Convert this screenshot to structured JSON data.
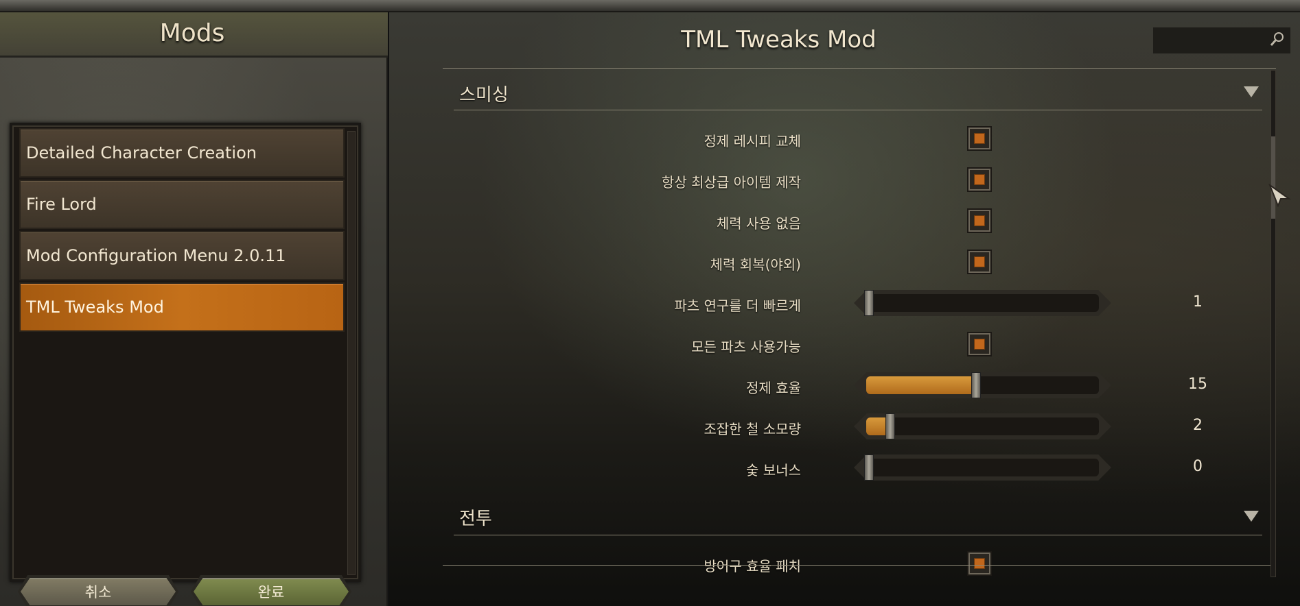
{
  "left_panel": {
    "title": "Mods",
    "mods": [
      {
        "label": "Detailed Character Creation",
        "selected": false
      },
      {
        "label": "Fire Lord",
        "selected": false
      },
      {
        "label": "Mod Configuration Menu 2.0.11",
        "selected": false
      },
      {
        "label": "TML Tweaks Mod",
        "selected": true
      }
    ],
    "buttons": {
      "cancel": "취소",
      "done": "완료"
    }
  },
  "right_panel": {
    "title": "TML Tweaks Mod",
    "search": {
      "placeholder": "",
      "icon": "search-icon"
    },
    "sections": [
      {
        "title": "스미싱",
        "settings": [
          {
            "label": "정제 레시피 교체",
            "type": "checkbox",
            "checked": true
          },
          {
            "label": "항상 최상급 아이템 제작",
            "type": "checkbox",
            "checked": true
          },
          {
            "label": "체력 사용 없음",
            "type": "checkbox",
            "checked": true
          },
          {
            "label": "체력 회복(야외)",
            "type": "checkbox",
            "checked": true
          },
          {
            "label": "파츠 연구를 더 빠르게",
            "type": "slider",
            "value": "1",
            "fill_fraction": 0.0
          },
          {
            "label": "모든 파츠 사용가능",
            "type": "checkbox",
            "checked": true
          },
          {
            "label": "정제 효율",
            "type": "slider",
            "value": "15",
            "fill_fraction": 0.46
          },
          {
            "label": "조잡한 철 소모량",
            "type": "slider",
            "value": "2",
            "fill_fraction": 0.09
          },
          {
            "label": "숯 보너스",
            "type": "slider",
            "value": "0",
            "fill_fraction": 0.0
          }
        ]
      },
      {
        "title": "전투",
        "settings": [
          {
            "label": "방어구 효율 패치",
            "type": "checkbox",
            "checked": true
          }
        ]
      }
    ]
  },
  "colors": {
    "accent": "#c4701a",
    "checkbox_fill": "#c2671c",
    "text": "#eadfc6"
  }
}
